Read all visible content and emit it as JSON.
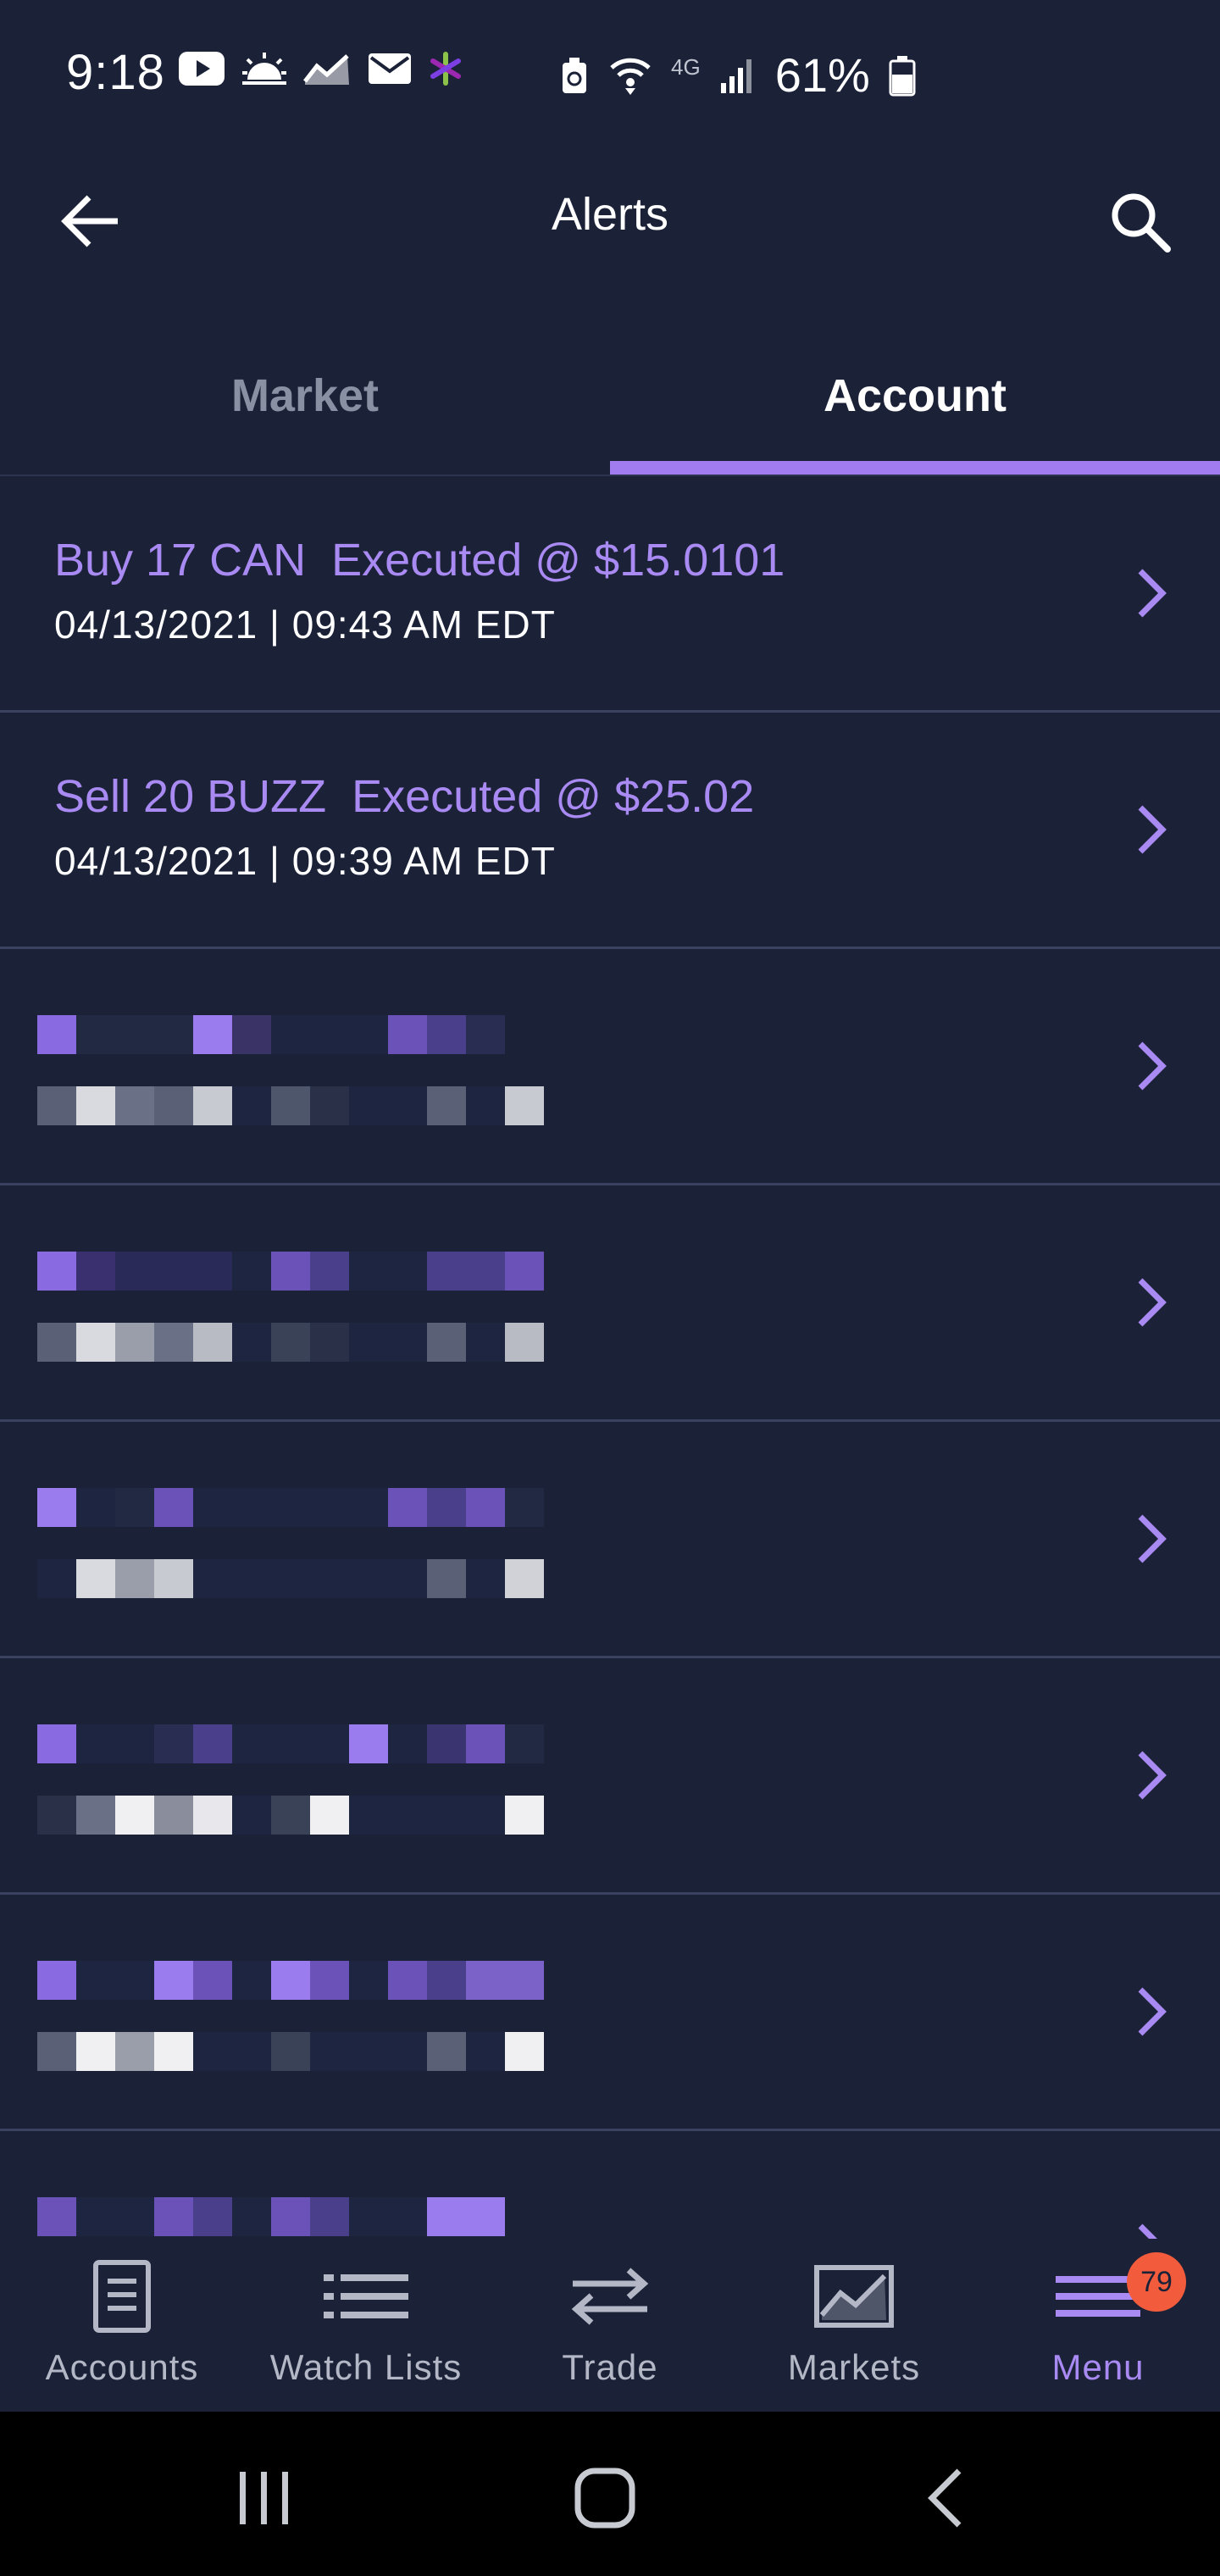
{
  "status_bar": {
    "time": "9:18",
    "battery_percent": "61%",
    "network": "4G"
  },
  "app_bar": {
    "title": "Alerts"
  },
  "tabs": [
    {
      "label": "Market",
      "active": false
    },
    {
      "label": "Account",
      "active": true
    }
  ],
  "alerts": [
    {
      "title": "Buy 17 CAN  Executed @ $15.0101",
      "date": "04/13/2021 | 09:43 AM EDT",
      "redacted": false
    },
    {
      "title": "Sell 20 BUZZ  Executed @ $25.02",
      "date": "04/13/2021 | 09:39 AM EDT",
      "redacted": false
    },
    {
      "title": "",
      "date": "",
      "redacted": true
    },
    {
      "title": "",
      "date": "",
      "redacted": true
    },
    {
      "title": "",
      "date": "",
      "redacted": true
    },
    {
      "title": "",
      "date": "",
      "redacted": true
    },
    {
      "title": "",
      "date": "",
      "redacted": true
    },
    {
      "title": "",
      "date": "",
      "redacted": true
    }
  ],
  "bottom_nav": [
    {
      "label": "Accounts",
      "icon": "document-icon",
      "active": false
    },
    {
      "label": "Watch Lists",
      "icon": "list-icon",
      "active": false
    },
    {
      "label": "Trade",
      "icon": "swap-arrows-icon",
      "active": false
    },
    {
      "label": "Markets",
      "icon": "chart-icon",
      "active": false
    },
    {
      "label": "Menu",
      "icon": "hamburger-icon",
      "active": true,
      "badge": "79"
    }
  ],
  "colors": {
    "background": "#1b2238",
    "accent": "#a07cf0",
    "alert_title": "#a98af2",
    "badge": "#f25c3c",
    "inactive_text": "#8a90a3"
  }
}
